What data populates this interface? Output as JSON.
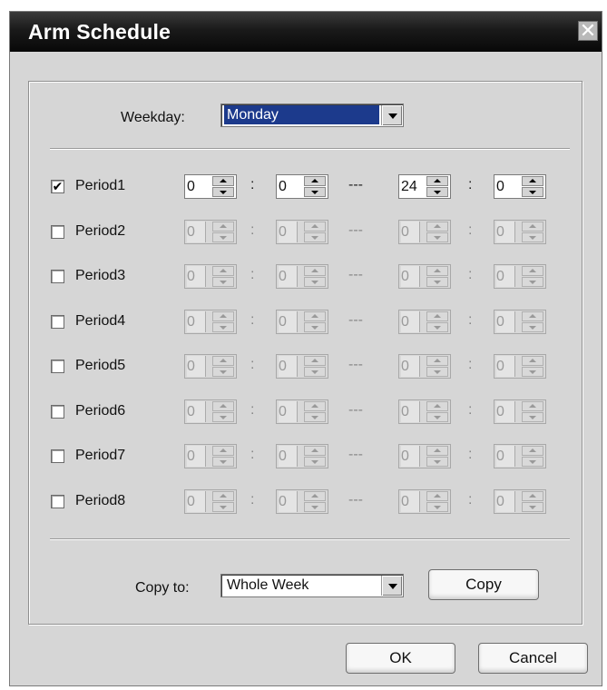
{
  "window": {
    "title": "Arm Schedule",
    "close_glyph": "✕"
  },
  "weekday": {
    "label": "Weekday:",
    "value": "Monday"
  },
  "time_colon": ":",
  "time_dash": "---",
  "periods": [
    {
      "label": "Period1",
      "checked": true,
      "start_hour": "0",
      "start_min": "0",
      "end_hour": "24",
      "end_min": "0"
    },
    {
      "label": "Period2",
      "checked": false,
      "start_hour": "0",
      "start_min": "0",
      "end_hour": "0",
      "end_min": "0"
    },
    {
      "label": "Period3",
      "checked": false,
      "start_hour": "0",
      "start_min": "0",
      "end_hour": "0",
      "end_min": "0"
    },
    {
      "label": "Period4",
      "checked": false,
      "start_hour": "0",
      "start_min": "0",
      "end_hour": "0",
      "end_min": "0"
    },
    {
      "label": "Period5",
      "checked": false,
      "start_hour": "0",
      "start_min": "0",
      "end_hour": "0",
      "end_min": "0"
    },
    {
      "label": "Period6",
      "checked": false,
      "start_hour": "0",
      "start_min": "0",
      "end_hour": "0",
      "end_min": "0"
    },
    {
      "label": "Period7",
      "checked": false,
      "start_hour": "0",
      "start_min": "0",
      "end_hour": "0",
      "end_min": "0"
    },
    {
      "label": "Period8",
      "checked": false,
      "start_hour": "0",
      "start_min": "0",
      "end_hour": "0",
      "end_min": "0"
    }
  ],
  "copy_to": {
    "label": "Copy to:",
    "value": "Whole Week",
    "button_label": "Copy"
  },
  "footer": {
    "ok_label": "OK",
    "cancel_label": "Cancel"
  },
  "colors": {
    "title_bar": "#111111",
    "selection_highlight": "#1c3a8c",
    "dialog_bg": "#d6d6d6"
  }
}
